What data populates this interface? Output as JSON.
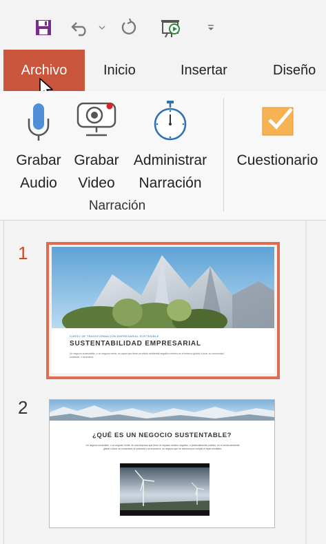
{
  "quick_access": {
    "icons": [
      "save-icon",
      "undo-icon",
      "redo-icon",
      "start-presentation-icon",
      "customize-toolbar-icon"
    ]
  },
  "tabs": [
    {
      "label": "Archivo",
      "active": true
    },
    {
      "label": "Inicio",
      "active": false
    },
    {
      "label": "Insertar",
      "active": false
    },
    {
      "label": "Diseño",
      "active": false
    }
  ],
  "ribbon": {
    "buttons": [
      {
        "line1": "Grabar",
        "line2": "Audio",
        "icon": "microphone-icon"
      },
      {
        "line1": "Grabar",
        "line2": "Video",
        "icon": "webcam-icon"
      },
      {
        "line1": "Administrar",
        "line2": "Narración",
        "icon": "stopwatch-icon"
      },
      {
        "line1": "Cuestionario",
        "line2": "",
        "icon": "quiz-checkbox-icon"
      }
    ],
    "group_label": "Narración"
  },
  "slides": [
    {
      "number": "1",
      "selected": true,
      "subtitle": "CURSO DE TRANSFORMACIÓN EMPRESARIAL SOSTENIBLE",
      "title": "SUSTENTABILIDAD EMPRESARIAL",
      "body": "Un negocio sustentable, o un negocio verde, es aquel que tiene un efecto ambiental negativo mínimo en el entorno global o local, su comunidad, sociedad, o economía."
    },
    {
      "number": "2",
      "selected": false,
      "title": "¿QUÉ ES UN NEGOCIO SUSTENTABLE?",
      "body": "Un negocio sostenible, o un negocio verde, es una empresa que tiene un impacto mínimo negativo, o potencialmente positivo, en el medio ambiente global o local, la comunidad, la sociedad o la economía, un negocio que se esfuerza por cumplir el triple resultado."
    }
  ],
  "colors": {
    "accent": "#c9563c",
    "selection": "#e0694e",
    "slide_number_selected": "#d24726",
    "title_blue": "#1f6ea8"
  }
}
